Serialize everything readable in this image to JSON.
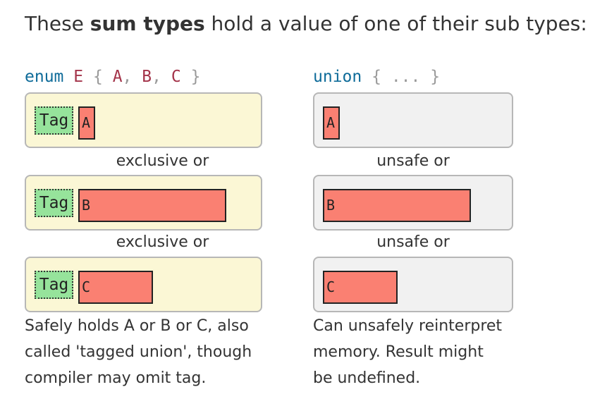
{
  "heading": {
    "prefix": "These ",
    "bold": "sum types",
    "suffix": " hold a value of one of their sub types:"
  },
  "enum_col": {
    "keyword": "enum",
    "type_name": "E",
    "open_brace": "{",
    "variant_a": "A",
    "comma_1": ",",
    "variant_b": "B",
    "comma_2": ",",
    "variant_c": "C",
    "close_brace": "}",
    "tag_label": "Tag",
    "rows": [
      {
        "label": "A"
      },
      {
        "label": "B"
      },
      {
        "label": "C"
      }
    ],
    "separator": "exclusive or",
    "caption_lines": [
      "Safely holds A or B or C, also",
      "called 'tagged union', though",
      "compiler may omit tag."
    ]
  },
  "union_col": {
    "keyword": "union",
    "open_brace": "{",
    "ellipsis": "...",
    "close_brace": "}",
    "rows": [
      {
        "label": "A"
      },
      {
        "label": "B"
      },
      {
        "label": "C"
      }
    ],
    "separator": "unsafe or",
    "caption_lines": [
      "Can unsafely reinterpret",
      "memory. Result might",
      "be undefined."
    ]
  },
  "colors": {
    "enum_box_bg": "#fbf7d5",
    "union_box_bg": "#f1f1f1",
    "tag_bg": "#96e39b",
    "payload_bg": "#fa8072",
    "keyword": "#0e6b99",
    "type_name": "#a4344a"
  }
}
